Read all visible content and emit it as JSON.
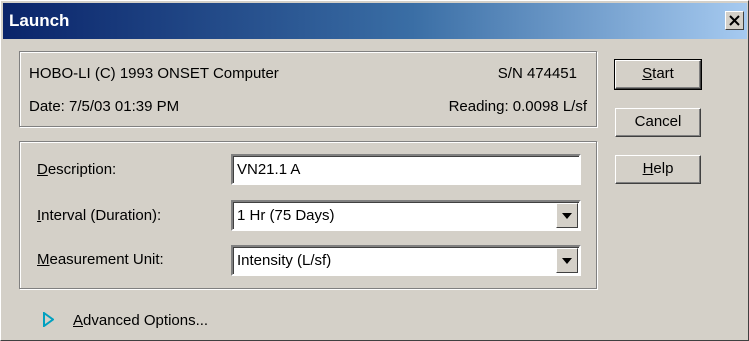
{
  "window": {
    "title": "Launch"
  },
  "info": {
    "device": "HOBO-LI (C) 1993 ONSET Computer",
    "serial": "S/N 474451",
    "date": "Date:  7/5/03 01:39 PM",
    "reading": "Reading: 0.0098 L/sf"
  },
  "form": {
    "description_label_u": "D",
    "description_label_rest": "escription:",
    "description_value": "VN21.1 A",
    "interval_label_u": "I",
    "interval_label_rest": "nterval (Duration):",
    "interval_value": "1 Hr (75 Days)",
    "unit_label_u": "M",
    "unit_label_rest": "easurement Unit:",
    "unit_value": "Intensity  (L/sf)"
  },
  "buttons": {
    "start_u": "S",
    "start_rest": "tart",
    "cancel": "Cancel",
    "help_u": "H",
    "help_rest": "elp"
  },
  "advanced": {
    "label_u": "A",
    "label_rest": "dvanced Options..."
  },
  "icons": {
    "close": "close-icon",
    "dropdown": "chevron-down-icon",
    "expand": "triangle-right-icon"
  },
  "colors": {
    "title_start": "#0a246a",
    "title_end": "#a6caf0",
    "face": "#d4d0c8",
    "expand_arrow": "#00a0c0"
  }
}
